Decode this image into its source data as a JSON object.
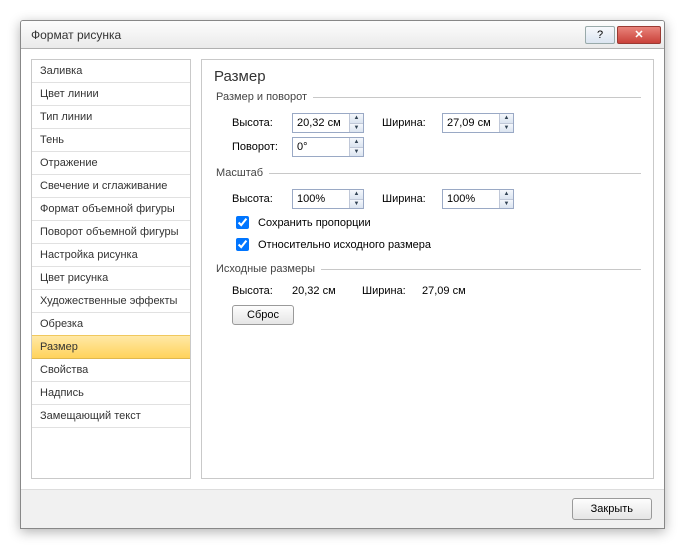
{
  "title": "Формат рисунка",
  "sidebar": {
    "items": [
      {
        "label": "Заливка"
      },
      {
        "label": "Цвет линии"
      },
      {
        "label": "Тип линии"
      },
      {
        "label": "Тень"
      },
      {
        "label": "Отражение"
      },
      {
        "label": "Свечение и сглаживание"
      },
      {
        "label": "Формат объемной фигуры"
      },
      {
        "label": "Поворот объемной фигуры"
      },
      {
        "label": "Настройка рисунка"
      },
      {
        "label": "Цвет рисунка"
      },
      {
        "label": "Художественные эффекты"
      },
      {
        "label": "Обрезка"
      },
      {
        "label": "Размер"
      },
      {
        "label": "Свойства"
      },
      {
        "label": "Надпись"
      },
      {
        "label": "Замещающий текст"
      }
    ],
    "selected_index": 12
  },
  "panel": {
    "heading": "Размер",
    "group_size_rotate": {
      "legend": "Размер и поворот",
      "height_label": "Высота:",
      "height_value": "20,32 см",
      "width_label": "Ширина:",
      "width_value": "27,09 см",
      "rotation_label": "Поворот:",
      "rotation_value": "0°"
    },
    "group_scale": {
      "legend": "Масштаб",
      "height_label": "Высота:",
      "height_value": "100%",
      "width_label": "Ширина:",
      "width_value": "100%",
      "lock_aspect_label": "Сохранить пропорции",
      "lock_aspect_checked": true,
      "relative_original_label": "Относительно исходного размера",
      "relative_original_checked": true
    },
    "group_original": {
      "legend": "Исходные размеры",
      "height_label": "Высота:",
      "height_value": "20,32 см",
      "width_label": "Ширина:",
      "width_value": "27,09 см",
      "reset_label": "Сброс"
    }
  },
  "footer": {
    "close_label": "Закрыть"
  }
}
